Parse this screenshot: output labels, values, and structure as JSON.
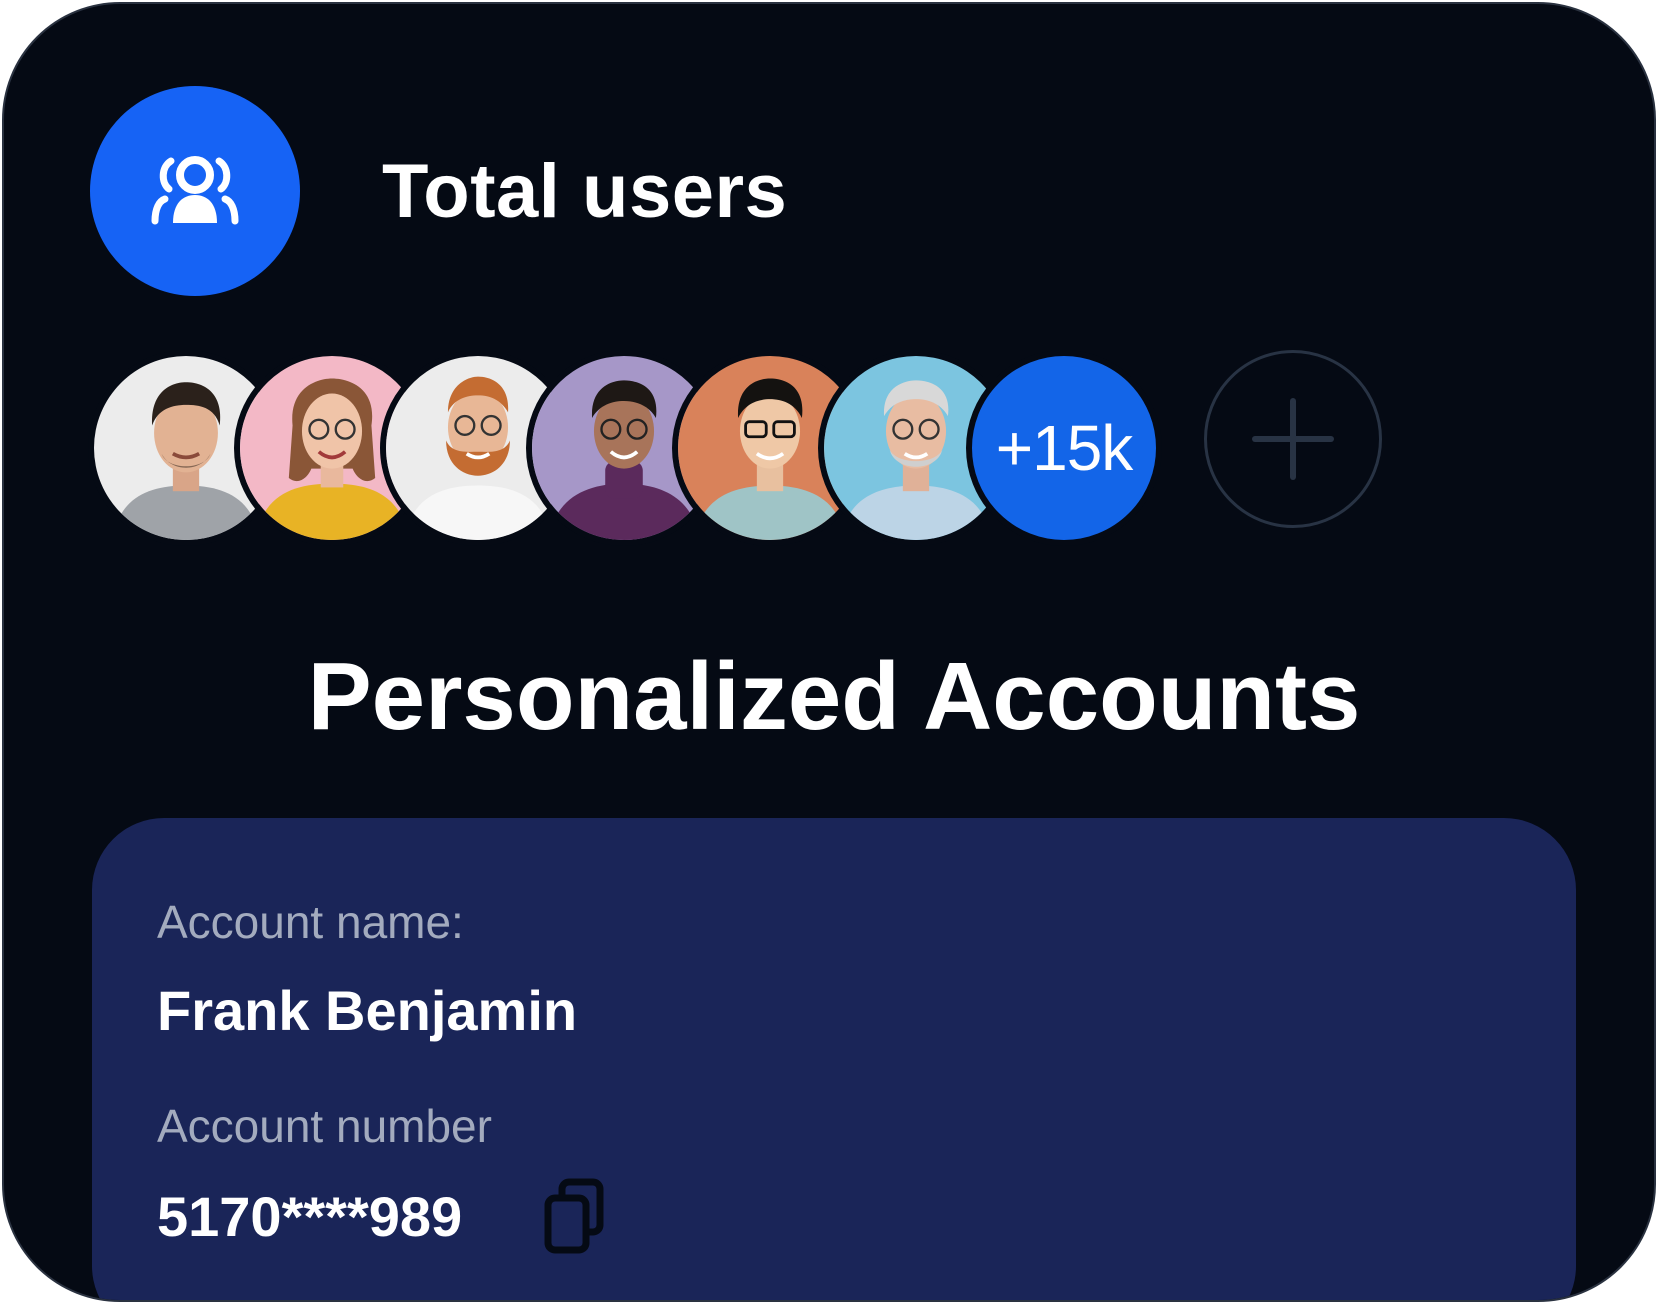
{
  "header": {
    "icon": "users-icon",
    "title": "Total users"
  },
  "avatars": [
    {
      "name": "user-avatar-1",
      "bg": "#ececec"
    },
    {
      "name": "user-avatar-2",
      "bg": "#f3b8c6"
    },
    {
      "name": "user-avatar-3",
      "bg": "#ececec"
    },
    {
      "name": "user-avatar-4",
      "bg": "#a697c8"
    },
    {
      "name": "user-avatar-5",
      "bg": "#d9825a"
    },
    {
      "name": "user-avatar-6",
      "bg": "#7cc5e0"
    }
  ],
  "more_count": "+15k",
  "add_button_icon": "plus-icon",
  "heading": "Personalized Accounts",
  "account": {
    "name_label": "Account name:",
    "name_value": "Frank Benjamin",
    "number_label": "Account number",
    "number_value": "5170****989",
    "copy_icon": "copy-icon"
  },
  "colors": {
    "background": "#050a14",
    "accent": "#1663f5",
    "card": "#1a2558"
  }
}
